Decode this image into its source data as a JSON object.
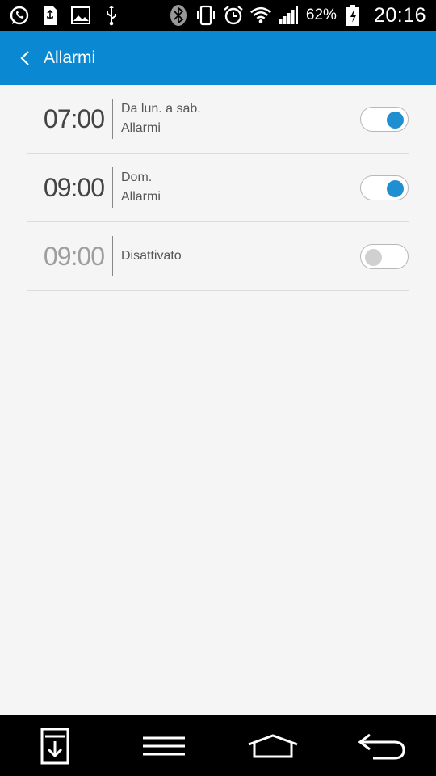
{
  "status_bar": {
    "left_icons": [
      "whatsapp-icon",
      "usb-storage-icon",
      "image-icon",
      "usb-icon"
    ],
    "right_icons": [
      "bluetooth-icon",
      "vibrate-icon",
      "alarm-clock-icon",
      "wifi-icon",
      "signal-icon",
      "battery-charging-icon"
    ],
    "battery": "62%",
    "time": "20:16"
  },
  "app_bar": {
    "title": "Allarmi",
    "background": "#0a88d2"
  },
  "alarms": [
    {
      "time": "07:00",
      "line1": "Da lun. a sab.",
      "line2": "Allarmi",
      "enabled": true
    },
    {
      "time": "09:00",
      "line1": "Dom.",
      "line2": "Allarmi",
      "enabled": true
    },
    {
      "time": "09:00",
      "line1": "Disattivato",
      "line2": "",
      "enabled": false
    }
  ],
  "nav_bar": {
    "buttons": [
      "download-icon",
      "menu-icon",
      "home-icon",
      "back-icon"
    ]
  },
  "colors": {
    "toggle_on": "#1e8fd0",
    "toggle_off": "#d0d0d0"
  }
}
